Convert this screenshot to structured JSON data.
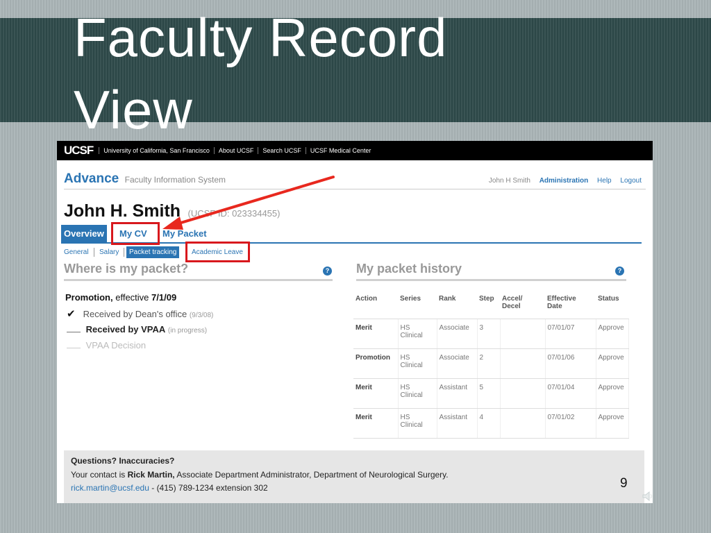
{
  "slide": {
    "title_line1": "Faculty Record",
    "title_line2": "View",
    "page_number": "9"
  },
  "topbar": {
    "logo": "UCSF",
    "links": [
      "University of California, San Francisco",
      "About UCSF",
      "Search UCSF",
      "UCSF Medical Center"
    ]
  },
  "header": {
    "brand": "Advance",
    "brand_sub": "Faculty Information System",
    "user": "John H Smith",
    "links": [
      "Administration",
      "Help",
      "Logout"
    ]
  },
  "person": {
    "name": "John H. Smith",
    "id": "(UCSF ID: 023334455)"
  },
  "tabs": [
    {
      "label": "Overview",
      "active": true
    },
    {
      "label": "My CV",
      "active": false
    },
    {
      "label": "My Packet",
      "active": false
    }
  ],
  "subtabs": [
    {
      "label": "General",
      "active": false
    },
    {
      "label": "Salary",
      "active": false
    },
    {
      "label": "Packet tracking",
      "active": true
    },
    {
      "label": "Academic Leave",
      "active": false
    }
  ],
  "packet_status": {
    "title": "Where is my packet?",
    "promotion_label": "Promotion,",
    "effective_label": "effective",
    "effective_date": "7/1/09",
    "items": [
      {
        "mark": "✔",
        "label": "Received by Dean's office",
        "note": "(9/3/08)",
        "state": "done"
      },
      {
        "mark": "",
        "label": "Received by VPAA",
        "note": "(in progress)",
        "state": "current"
      },
      {
        "mark": "",
        "label": "VPAA Decision",
        "note": "",
        "state": "pending"
      }
    ]
  },
  "history": {
    "title": "My packet history",
    "columns": [
      "Action",
      "Series",
      "Rank",
      "Step",
      "Accel/ Decel",
      "Effective Date",
      "Status"
    ],
    "rows": [
      {
        "action": "Merit",
        "series": "HS Clinical",
        "rank": "Associate",
        "step": "3",
        "accel": "",
        "date": "07/01/07",
        "status": "Approve"
      },
      {
        "action": "Promotion",
        "series": "HS Clinical",
        "rank": "Associate",
        "step": "2",
        "accel": "",
        "date": "07/01/06",
        "status": "Approve"
      },
      {
        "action": "Merit",
        "series": "HS Clinical",
        "rank": "Assistant",
        "step": "5",
        "accel": "",
        "date": "07/01/04",
        "status": "Approve"
      },
      {
        "action": "Merit",
        "series": "HS Clinical",
        "rank": "Assistant",
        "step": "4",
        "accel": "",
        "date": "07/01/02",
        "status": "Approve"
      }
    ]
  },
  "contact": {
    "question": "Questions? Inaccuracies?",
    "prefix": "Your contact is",
    "name": "Rick Martin,",
    "role": "Associate Department Administrator, Department of Neurological Surgery.",
    "email": "rick.martin@ucsf.edu",
    "phone": "- (415) 789-1234 extension 302"
  },
  "colors": {
    "accent": "#2a74b3",
    "highlight": "#d8181d",
    "title_band": "#2f4b4b"
  },
  "icons": {
    "help": "help-icon",
    "speaker": "speaker-icon",
    "arrow": "annotation-arrow"
  }
}
